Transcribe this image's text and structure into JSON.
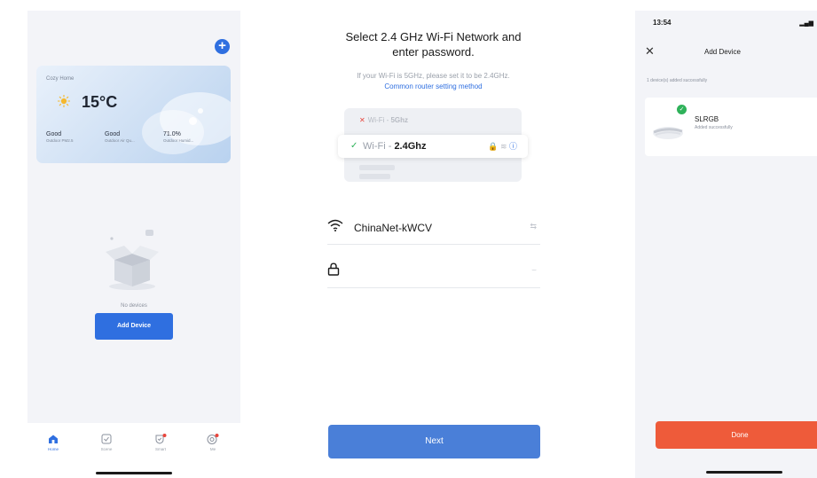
{
  "home_screen": {
    "weather": {
      "home_name": "Cozy Home",
      "temperature": "15°C",
      "metrics": [
        {
          "value": "Good",
          "label": "Outdoor PM2.5"
        },
        {
          "value": "Good",
          "label": "Outdoor Air Qu..."
        },
        {
          "value": "71.0%",
          "label": "Outdoor Humid..."
        }
      ]
    },
    "empty_text": "No devices",
    "add_device_label": "Add Device",
    "tabs": [
      {
        "label": "Home",
        "icon": "home-icon",
        "active": true
      },
      {
        "label": "Scene",
        "icon": "scene-icon",
        "active": false
      },
      {
        "label": "Smart",
        "icon": "smart-icon",
        "active": false
      },
      {
        "label": "Me",
        "icon": "me-icon",
        "active": false
      }
    ],
    "accent_color": "#2f6fe0"
  },
  "wifi_screen": {
    "title_line1": "Select 2.4 GHz Wi-Fi Network and",
    "title_line2": "enter password.",
    "subtitle": "If your Wi-Fi is 5GHz, please set it to be 2.4GHz.",
    "router_link": "Common router setting method",
    "illustration": {
      "wifi_5g_prefix": "Wi-Fi - ",
      "wifi_5g_band": "5Ghz",
      "wifi_24_prefix": "Wi-Fi - ",
      "wifi_24_band": "2.4Ghz"
    },
    "network_name": "ChinaNet-kWCV",
    "password": "",
    "next_label": "Next",
    "button_color": "#4a7fd8"
  },
  "add_device_screen": {
    "status_time": "13:54",
    "header_title": "Add Device",
    "added_summary": "1 device(s) added successfully",
    "device": {
      "name": "SLRGB",
      "status": "Added successfully"
    },
    "done_label": "Done",
    "done_color": "#ee5b3a"
  }
}
